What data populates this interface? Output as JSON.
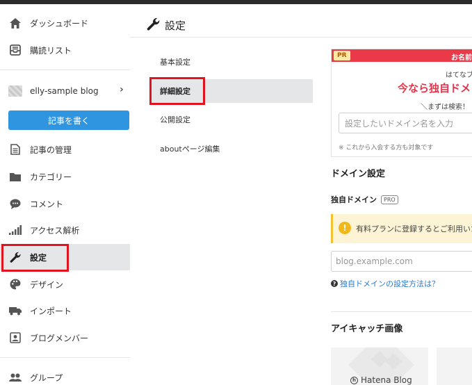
{
  "sidebar": {
    "items_top": [
      {
        "label": "ダッシュボード",
        "icon": "home-icon"
      },
      {
        "label": "購読リスト",
        "icon": "inbox-icon"
      }
    ],
    "blog_name": "elly-sample blog",
    "write_button": "記事を書く",
    "items": [
      {
        "label": "記事の管理",
        "icon": "document-icon"
      },
      {
        "label": "カテゴリー",
        "icon": "folder-icon"
      },
      {
        "label": "コメント",
        "icon": "comment-icon"
      },
      {
        "label": "アクセス解析",
        "icon": "bar-chart-icon"
      },
      {
        "label": "設定",
        "icon": "wrench-icon"
      },
      {
        "label": "デザイン",
        "icon": "palette-icon"
      },
      {
        "label": "インポート",
        "icon": "import-icon"
      },
      {
        "label": "ブログメンバー",
        "icon": "member-icon"
      }
    ],
    "group_label": "グループ"
  },
  "header": {
    "title": "設定"
  },
  "submenu": [
    "基本設定",
    "詳細設定",
    "公開設定",
    "aboutページ編集"
  ],
  "promo": {
    "tag": "PR",
    "bar_text": "お名前.",
    "sub": "はてなブ",
    "headline": "今なら独自ドメ",
    "search_hint": "＼まずは検索！",
    "input_placeholder": "設定したいドメイン名を入力",
    "note": "※ これから入会する方も対象です"
  },
  "domain": {
    "section_title": "ドメイン設定",
    "label": "独自ドメイン",
    "pro_badge": "PRO",
    "notice": "有料プランに登録するとご利用いた",
    "input_placeholder": "blog.example.com",
    "help_link": "独自ドメインの設定方法は？"
  },
  "eyecatch": {
    "section_title": "アイキャッチ画像",
    "logo_text": "Hatena Blog"
  },
  "colors": {
    "accent": "#2f95e0",
    "highlight": "#e0141e",
    "pr_bar": "#ea3a4a"
  }
}
